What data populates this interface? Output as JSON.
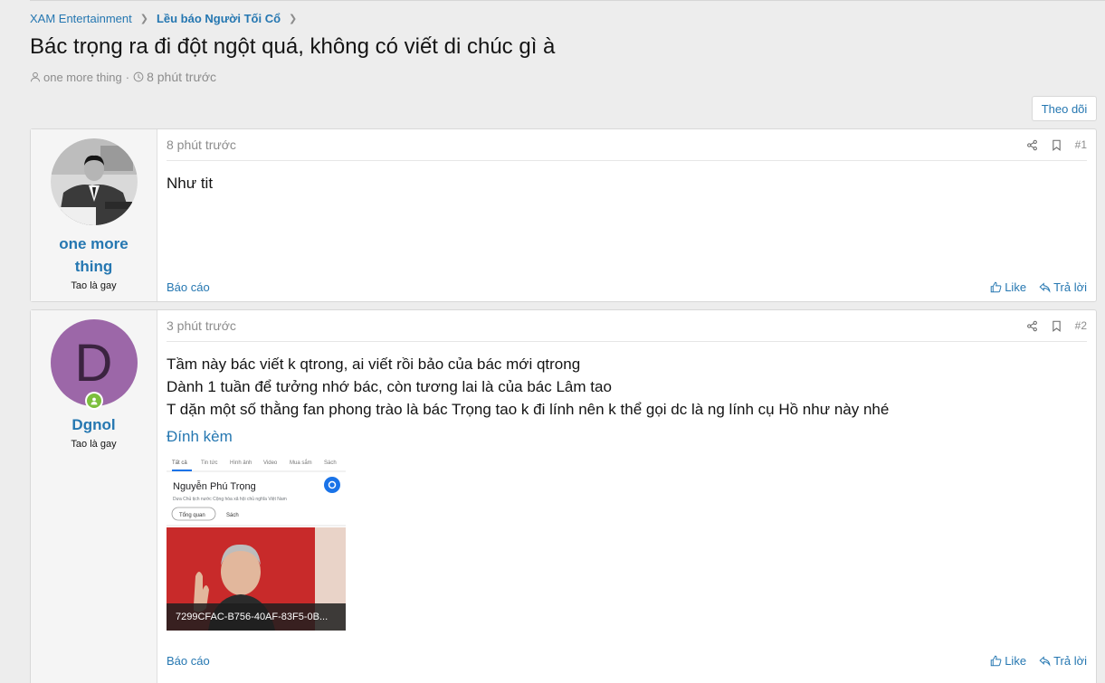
{
  "breadcrumb": {
    "items": [
      "XAM Entertainment",
      "Lều báo Người Tối Cổ"
    ]
  },
  "thread": {
    "title": "Bác trọng ra đi đột ngột quá, không có viết di chúc gì à",
    "author": "one more thing",
    "time": "8 phút trước"
  },
  "follow_button": "Theo dõi",
  "posts": [
    {
      "username_line1": "one more",
      "username_line2": "thing",
      "user_title": "Tao là gay",
      "time": "8 phút trước",
      "number": "#1",
      "body": [
        "Như tit"
      ],
      "report": "Báo cáo",
      "like": "Like",
      "reply": "Trả lời"
    },
    {
      "username": "Dgnol",
      "avatar_letter": "D",
      "avatar_color": "#9c67a8",
      "user_title": "Tao là gay",
      "time": "3 phút trước",
      "number": "#2",
      "body": [
        "Tầm này bác viết k qtrong, ai viết rồi bảo của bác mới qtrong",
        "Dành 1 tuần để tưởng nhớ bác, còn tương lai là của bác Lâm tao",
        "T dặn một số thằng fan phong trào là bác Trọng tao k đi lính nên k thể gọi dc là ng lính cụ Hồ như này nhé"
      ],
      "attachments_label": "Đính kèm",
      "attachment": {
        "filename": "7299CFAC-B756-40AF-83F5-0B...",
        "tabs": [
          "Tất cả",
          "Tin tức",
          "Hình ảnh",
          "Video",
          "Mua sắm",
          "Sách"
        ],
        "result_title": "Nguyễn Phú Trọng",
        "result_subtitle": "Dưa Chủ tịch nước Cộng hòa xã hội chủ nghĩa Việt Nam",
        "chips": [
          "Tổng quan",
          "Sách"
        ]
      },
      "report": "Báo cáo",
      "like": "Like",
      "reply": "Trả lời"
    }
  ],
  "colors": {
    "link": "#2577b1",
    "background": "#ededed",
    "online": "#7cbf3d"
  }
}
